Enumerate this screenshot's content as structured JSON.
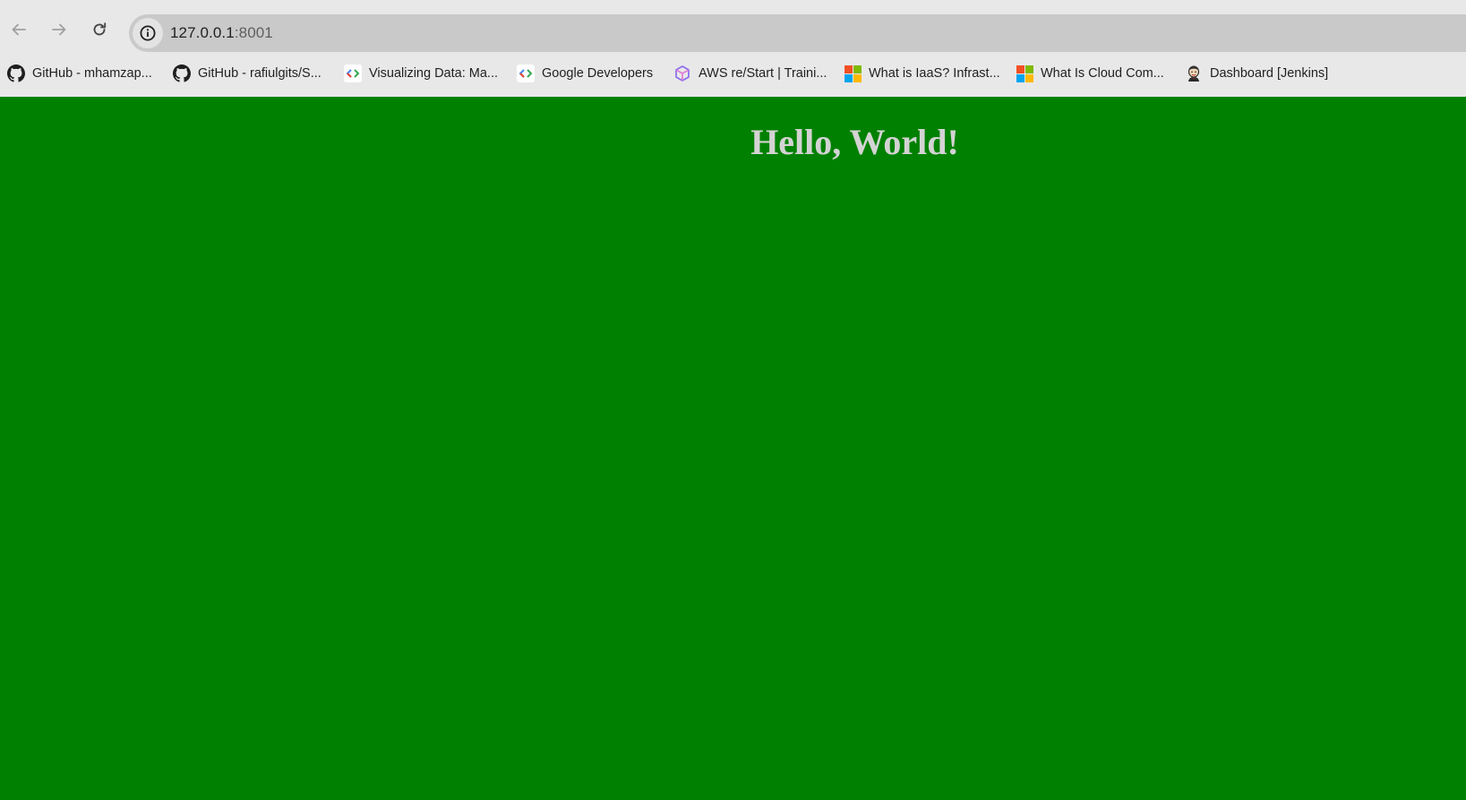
{
  "browser": {
    "url_host": "127.0.0.1",
    "url_port": ":8001",
    "colors": {
      "chrome_bg": "#e8e8e8",
      "omnibox_bg": "#c9c9c9"
    }
  },
  "bookmarks": [
    {
      "label": "GitHub - mhamzap...",
      "icon": "github-icon"
    },
    {
      "label": "GitHub - rafiulgits/S...",
      "icon": "github-icon"
    },
    {
      "label": "Visualizing Data: Ma...",
      "icon": "google-developers-icon"
    },
    {
      "label": "Google Developers",
      "icon": "google-developers-icon"
    },
    {
      "label": "AWS re/Start | Traini...",
      "icon": "aws-cube-icon"
    },
    {
      "label": "What is IaaS? Infrast...",
      "icon": "microsoft-logo-icon"
    },
    {
      "label": "What Is Cloud Com...",
      "icon": "microsoft-logo-icon"
    },
    {
      "label": "Dashboard [Jenkins]",
      "icon": "jenkins-icon"
    }
  ],
  "page": {
    "heading": "Hello, World!",
    "colors": {
      "background": "#008000",
      "heading": "#d3d3d3"
    }
  }
}
